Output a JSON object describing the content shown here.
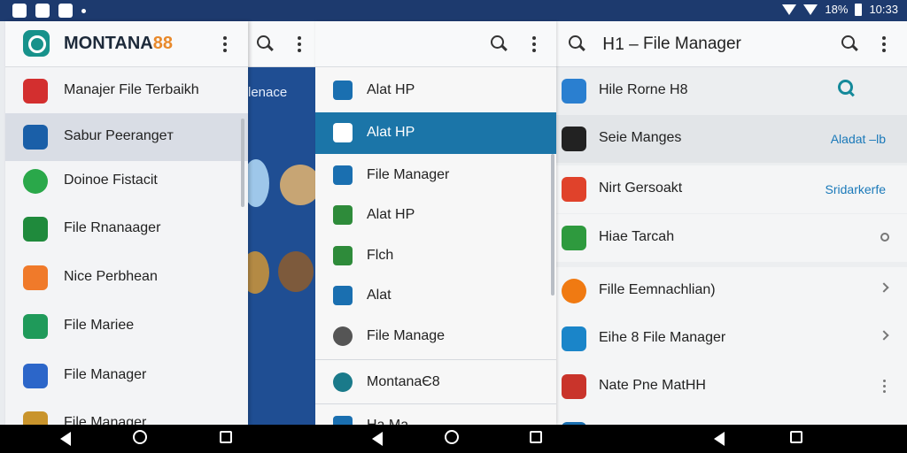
{
  "status": {
    "battery_text": "18%",
    "time": "10:33"
  },
  "panel1": {
    "brand_main": "MONTANA",
    "brand_accent": "88",
    "items": [
      {
        "label": "Manajer File Terbaikh",
        "color": "#d32f2f"
      },
      {
        "label": "Sabur Peerangeт",
        "color": "#1a5fa8"
      },
      {
        "label": "Doinoe Fistacit",
        "color": "#2aa84a"
      },
      {
        "label": "File Rnanaager",
        "color": "#1f8a3c"
      },
      {
        "label": "Nice Perbhean",
        "color": "#f07a2a"
      },
      {
        "label": "File Mariee",
        "color": "#1f9a5a"
      },
      {
        "label": "File Manager",
        "color": "#2c66c9"
      },
      {
        "label": "File Manager",
        "color": "#c9942c"
      }
    ]
  },
  "panel2": {
    "stage_label": "lenace"
  },
  "panel3": {
    "items": [
      {
        "label": "Alat HP",
        "color": "#1a6fb0"
      },
      {
        "label": "Alat HP",
        "color": "#ffffff"
      },
      {
        "label": "File Manager",
        "color": "#1a6fb0"
      },
      {
        "label": "Alat HP",
        "color": "#2e8b3a"
      },
      {
        "label": "Flch",
        "color": "#2e8b3a"
      },
      {
        "label": "Alat",
        "color": "#1a6fb0"
      },
      {
        "label": "File Manage",
        "color": "#555555"
      },
      {
        "label": "MontanaЄ8",
        "color": "#1a7a8a"
      },
      {
        "label": "Ha Ma",
        "color": "#1a6fb0"
      }
    ]
  },
  "panel4": {
    "header_title": "File Manager",
    "header_prefix": "ᕼ1 –",
    "items": [
      {
        "label": "Hile Rorne H8",
        "side": "",
        "color": "#2a7fd0"
      },
      {
        "label": "Seie Manges",
        "side": "Aladat –lb",
        "color": "#222222"
      },
      {
        "label": "Nirt Gersoakt",
        "side": "Sridarkerfe",
        "color": "#e0422b"
      },
      {
        "label": "Hiae Tarcah",
        "side": "",
        "color": "#2e9a3e"
      },
      {
        "label": "Fille Eemnachlian)",
        "side": "",
        "color": "#f07a12"
      },
      {
        "label": "Eihe 8 File Manager",
        "side": "",
        "color": "#1a85c9"
      },
      {
        "label": "Nate Pne MatHH",
        "side": "",
        "color": "#c9342b"
      }
    ]
  }
}
